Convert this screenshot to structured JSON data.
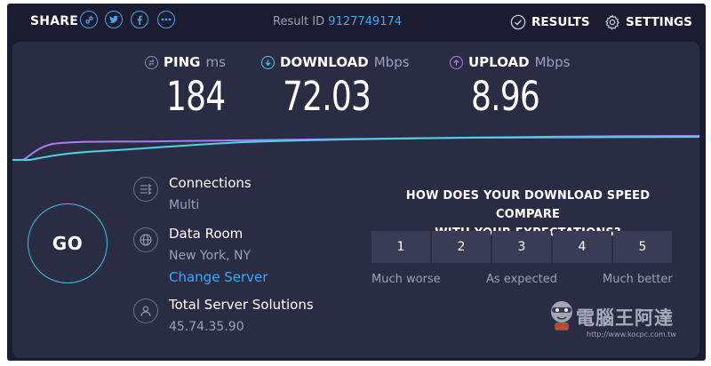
{
  "topbar": {
    "share_label": "SHARE",
    "share_icons": [
      "link-icon",
      "twitter-icon",
      "twitter-icon",
      "facebook-icon",
      "more-icon"
    ],
    "result_id_label": "Result ID",
    "result_id_value": "9127749174",
    "results_label": "RESULTS",
    "settings_label": "SETTINGS"
  },
  "metrics": {
    "ping": {
      "label": "PING",
      "unit": "ms",
      "value": "184",
      "color": "#8a90a8"
    },
    "download": {
      "label": "DOWNLOAD",
      "unit": "Mbps",
      "value": "72.03",
      "color": "#4fd1e8"
    },
    "upload": {
      "label": "UPLOAD",
      "unit": "Mbps",
      "value": "8.96",
      "color": "#b07ef0"
    }
  },
  "go_label": "GO",
  "server": {
    "connections_label": "Connections",
    "connections_value": "Multi",
    "data_room_label": "Data Room",
    "data_room_location": "New York, NY",
    "change_server_label": "Change Server",
    "host_name": "Total Server Solutions",
    "host_ip": "45.74.35.90"
  },
  "survey": {
    "question_line1": "HOW DOES YOUR DOWNLOAD SPEED COMPARE",
    "question_line2": "WITH YOUR EXPECTATIONS?",
    "options": [
      "1",
      "2",
      "3",
      "4",
      "5"
    ],
    "label_low": "Much worse",
    "label_mid": "As expected",
    "label_high": "Much better"
  },
  "watermark": {
    "text": "電腦王阿達",
    "url": "http://www.kocpc.com.tw"
  }
}
